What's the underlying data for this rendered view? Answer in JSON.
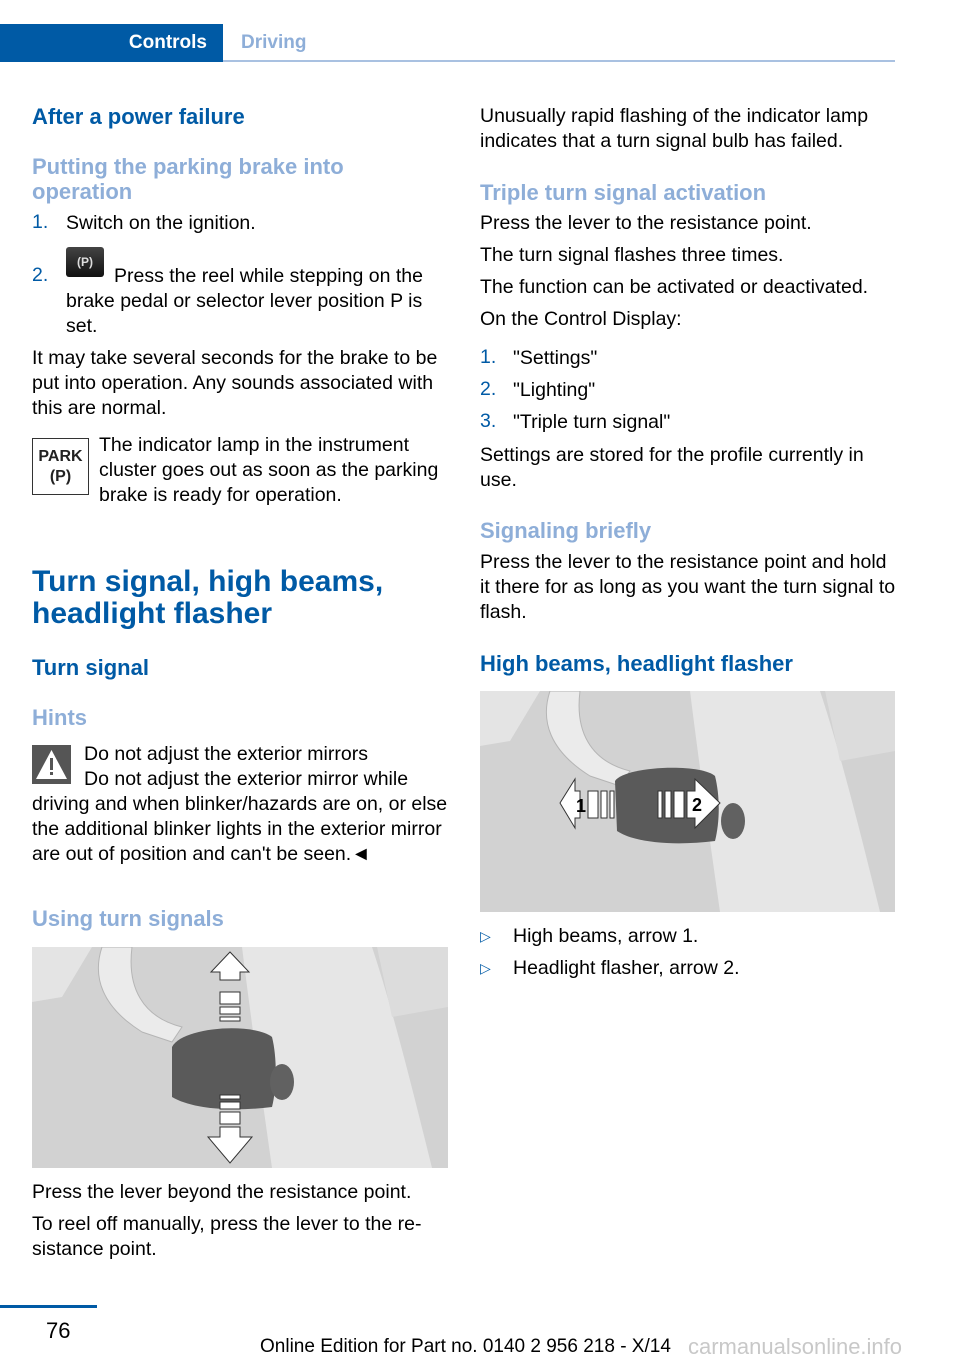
{
  "header": {
    "tabs": [
      {
        "label": "Controls",
        "active": true
      },
      {
        "label": "Driving",
        "active": false
      }
    ]
  },
  "left": {
    "power_failure_heading": "After a power failure",
    "parking_brake_heading": "Putting the parking brake into operation",
    "steps": [
      {
        "num": "1.",
        "text": "Switch on the ignition."
      },
      {
        "num": "2.",
        "icon": "parking-brake-button-icon",
        "text": "Press the reel while stepping on the brake pedal or selector lever position P is set."
      }
    ],
    "brake_note": "It may take several seconds for the brake to be put into operation. Any sounds associated with this are normal.",
    "indicator_icon_label": "PARK",
    "indicator_icon_symbol": "(P)",
    "indicator_note": "The indicator lamp in the instrument cluster goes out as soon as the parking brake is ready for operation.",
    "section_title": "Turn signal, high beams, headlight flasher",
    "turn_signal_heading": "Turn signal",
    "hints_heading": "Hints",
    "warning_title": "Do not adjust the exterior mirrors",
    "warning_text": "Do not adjust the exterior mirror while driving and when blinker/hazards are on, or else the additional blinker lights in the exterior mirror are out of position and can't be seen.◄",
    "using_heading": "Using turn signals",
    "figure1_desc": "turn signal lever with up/down arrows",
    "after_fig_1": "Press the lever beyond the resistance point.",
    "after_fig_2": "To reel off manually, press the lever to the re-sistance point."
  },
  "right": {
    "rapid_flash": "Unusually rapid flashing of the indicator lamp indicates that a turn signal bulb has failed.",
    "triple_heading": "Triple turn signal activation",
    "triple_p1": "Press the lever to the resistance point.",
    "triple_p2": "The turn signal flashes three times.",
    "triple_p3": "The function can be activated or deactivated.",
    "triple_p4": "On the Control Display:",
    "menu_steps": [
      {
        "num": "1.",
        "text": "\"Settings\""
      },
      {
        "num": "2.",
        "text": "\"Lighting\""
      },
      {
        "num": "3.",
        "text": "\"Triple turn signal\""
      }
    ],
    "settings_stored": "Settings are stored for the profile currently in use.",
    "signaling_heading": "Signaling briefly",
    "signaling_text": "Press the lever to the resistance point and hold it there for as long as you want the turn signal to flash.",
    "high_beams_heading": "High beams, headlight flasher",
    "figure2_arrow1": "1",
    "figure2_arrow2": "2",
    "bullets": [
      "High beams, arrow 1.",
      "Headlight flasher, arrow 2."
    ]
  },
  "footer": {
    "page_number": "76",
    "edition": "Online Edition for Part no. 0140 2 956 218 - X/14",
    "watermark": "carmanualsonline.info"
  },
  "colors": {
    "brand_blue": "#005aa5",
    "light_blue": "#8eaed8"
  }
}
